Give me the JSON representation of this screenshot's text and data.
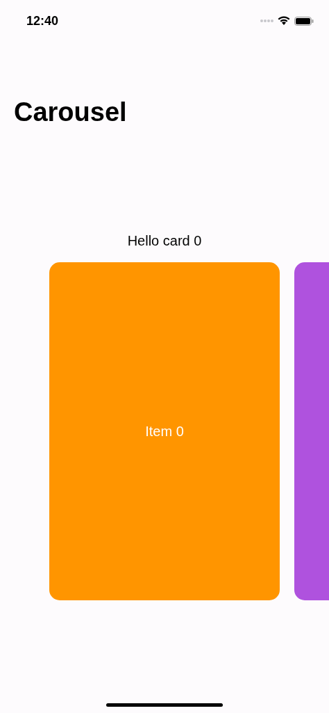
{
  "status_bar": {
    "time": "12:40"
  },
  "title": "Carousel",
  "card_heading": "Hello card 0",
  "cards": [
    {
      "label": "Item 0",
      "color": "#ff9500"
    },
    {
      "color": "#af52de"
    }
  ]
}
